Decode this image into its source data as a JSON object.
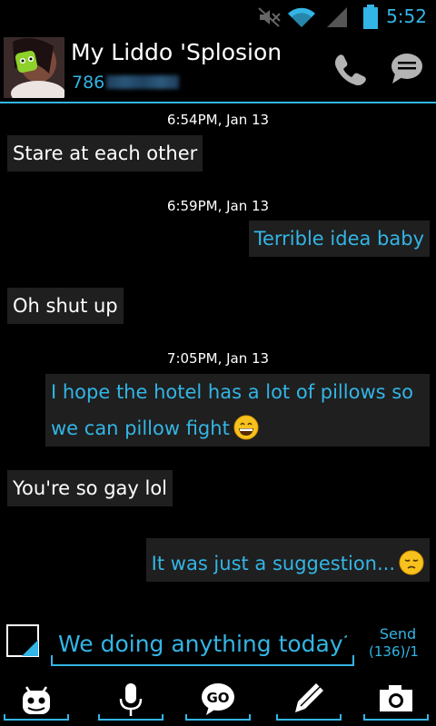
{
  "status_bar": {
    "time": "5:52",
    "icons": [
      "mute-icon",
      "wifi-icon",
      "signal-icon",
      "battery-icon"
    ]
  },
  "header": {
    "contact_name": "My Liddo 'Splosion",
    "contact_number_visible": "786",
    "call_icon": "phone-icon",
    "message_icon": "chat-bubble-icon"
  },
  "conversation": {
    "timestamps": [
      "6:54PM, Jan 13",
      "6:59PM, Jan 13",
      "7:05PM, Jan 13"
    ],
    "messages": [
      {
        "direction": "in",
        "text": "Stare at each other"
      },
      {
        "direction": "out",
        "text": "Terrible idea baby"
      },
      {
        "direction": "in",
        "text": "Oh shut up"
      },
      {
        "direction": "out",
        "text_line1": "I hope the hotel has a lot of pillows so",
        "text_line2": "we can pillow fight",
        "emoji": "grinning-emoji"
      },
      {
        "direction": "in",
        "text": "You're so gay lol"
      },
      {
        "direction": "out",
        "text": "It was just a suggestion...",
        "emoji": "pensive-emoji"
      }
    ]
  },
  "compose": {
    "value": "We doing anything today?",
    "send_label": "Send",
    "char_count": "(136)/1"
  },
  "toolbar": {
    "items": [
      "android-icon",
      "microphone-icon",
      "go-icon",
      "pencil-icon",
      "camera-icon"
    ]
  },
  "colors": {
    "accent": "#33b5e5",
    "bubble": "#1f1f1f",
    "background": "#000000"
  }
}
